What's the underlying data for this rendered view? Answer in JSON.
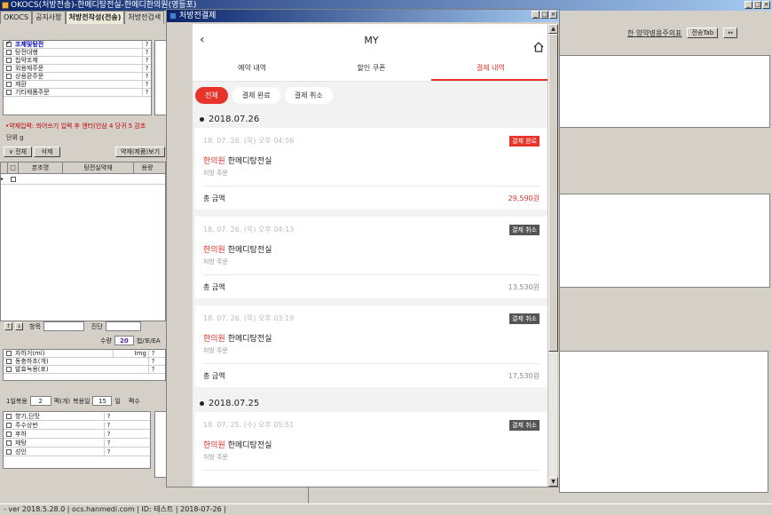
{
  "main_window": {
    "title": "OKOCS(처방전송)-한메디탕전실-한메디한의원(영등포)"
  },
  "tabs": [
    "OKOCS",
    "공지사항",
    "처방전작성(전송)",
    "처방전검색"
  ],
  "categories": [
    {
      "label": "조제및탕전",
      "checked": true,
      "q": "?"
    },
    {
      "label": "탕전대행",
      "checked": false,
      "q": "?"
    },
    {
      "label": "첩약조제",
      "checked": false,
      "q": "?"
    },
    {
      "label": "외용제주문",
      "checked": false,
      "q": "?"
    },
    {
      "label": "상용환주문",
      "checked": false,
      "q": "?"
    },
    {
      "label": "제환",
      "checked": false,
      "q": "?"
    },
    {
      "label": "기타제품주문",
      "checked": false,
      "q": "?"
    }
  ],
  "hint": "•약재입력: 띄어쓰기 입력 후 엔터(인삼 4 당귀 5 감초",
  "unit_label": "단위 g",
  "btn_select_all": "∨ 전체",
  "btn_delete": "삭제",
  "btn_herb_view": "약재(제품)보기",
  "grid_headers": [
    "본초명",
    "탕전실약재",
    "용량"
  ],
  "lower": {
    "item_label": "항목",
    "diag_label": "진단",
    "qty_label": "수량",
    "qty_value": "20",
    "qty_unit": "첩/포/EA",
    "items": [
      {
        "label": "자하거(ml)",
        "col": "Img",
        "q": "?"
      },
      {
        "label": "동충하초(개)",
        "col": "",
        "q": "?"
      },
      {
        "label": "발효녹용(포)",
        "col": "",
        "q": "?"
      }
    ],
    "dose_label": "1일복용",
    "dose_value": "2",
    "dose_unit": "팩(개)",
    "days_label": "복용일",
    "days_value": "15",
    "days_unit": "일",
    "pack_label": "팩수",
    "options": [
      {
        "label": "향기,단맛",
        "q": "?"
      },
      {
        "label": "주수상반",
        "q": "?"
      },
      {
        "label": "후하",
        "q": "?"
      },
      {
        "label": "재탕",
        "q": "?"
      },
      {
        "label": "성인",
        "q": "?"
      }
    ]
  },
  "right_header": {
    "link": "한 양약병용주의표",
    "btn_send_tab": "전송Tab",
    "btn_arrows": "↔"
  },
  "status_bar": "- ver 2018.5.28.0  |  ocs.hanmedi.com  |  ID: 테스트  |  2018-07-26  |",
  "popup": {
    "title": "처방전결제",
    "header": "MY",
    "tabs": [
      "예약 내역",
      "할인 쿠폰",
      "결제 내역"
    ],
    "active_tab": 2,
    "chips": [
      "전체",
      "결제 완료",
      "결제 취소"
    ],
    "groups": [
      {
        "date": "2018.07.26",
        "orders": [
          {
            "datetime": "18. 07. 26. (목) 오후 04:56",
            "status": "결제 완료",
            "paid": true,
            "clinic": "한의원",
            "place": "한메디탕전실",
            "type": "처방 주문",
            "total_label": "총 금액",
            "total": "29,590원"
          },
          {
            "datetime": "18. 07. 26. (목) 오후 04:13",
            "status": "결제 취소",
            "paid": false,
            "clinic": "한의원",
            "place": "한메디탕전실",
            "type": "처방 주문",
            "total_label": "총 금액",
            "total": "13,530원"
          },
          {
            "datetime": "18. 07. 26. (목) 오후 03:19",
            "status": "결제 취소",
            "paid": false,
            "clinic": "한의원",
            "place": "한메디탕전실",
            "type": "처방 주문",
            "total_label": "총 금액",
            "total": "17,530원"
          }
        ]
      },
      {
        "date": "2018.07.25",
        "orders": [
          {
            "datetime": "18. 07. 25. (수) 오후 05:51",
            "status": "결제 취소",
            "paid": false,
            "clinic": "한의원",
            "place": "한메디탕전실",
            "type": "처방 주문",
            "total_label": "",
            "total": ""
          }
        ]
      }
    ]
  }
}
